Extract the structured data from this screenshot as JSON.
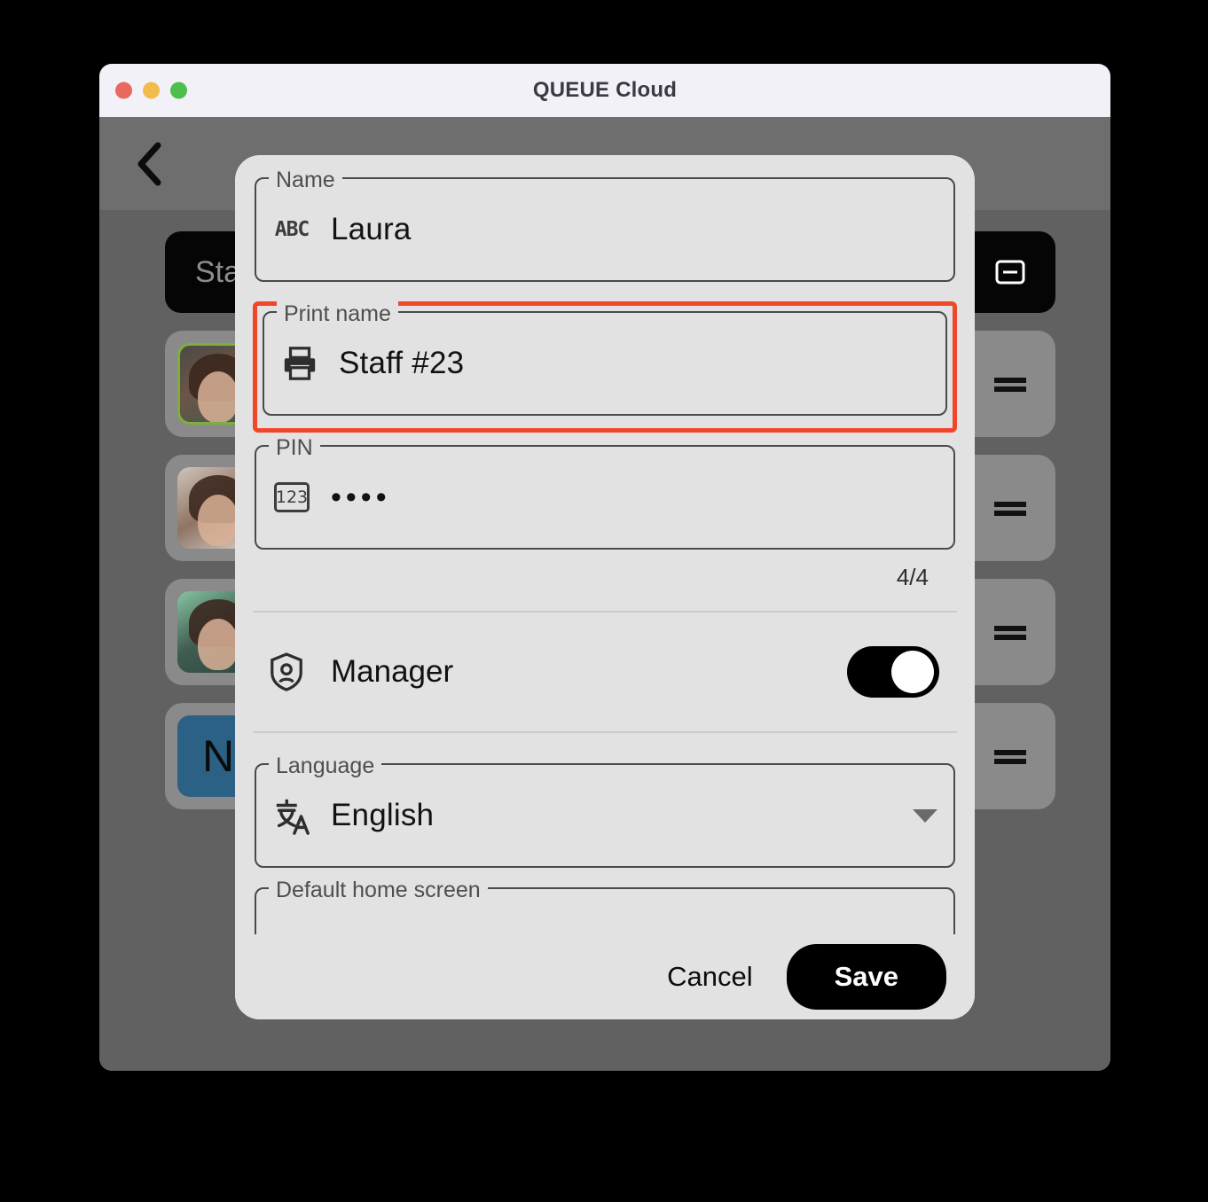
{
  "window": {
    "title": "QUEUE Cloud",
    "traffic_lights": [
      {
        "name": "close",
        "color": "#e8695e"
      },
      {
        "name": "minimize",
        "color": "#f0bc4d"
      },
      {
        "name": "zoom",
        "color": "#4cbf4f"
      }
    ]
  },
  "background": {
    "page_title": "Staff",
    "back_label": "",
    "black_button_label": "Sta",
    "rows": [
      {
        "name": "staff-row-1",
        "avatar": "photo-woman-long-hair",
        "selected": true
      },
      {
        "name": "staff-row-2",
        "avatar": "photo-woman-glasses",
        "selected": false
      },
      {
        "name": "staff-row-3",
        "avatar": "photo-man-beard",
        "selected": false
      },
      {
        "name": "staff-row-4",
        "avatar": "initial-tile",
        "initial": "N",
        "selected": false
      }
    ]
  },
  "dialog": {
    "fields": {
      "name": {
        "label": "Name",
        "value": "Laura",
        "icon": "abc-icon",
        "icon_text": "ABC"
      },
      "print_name": {
        "label": "Print name",
        "value": "Staff #23",
        "icon": "printer-icon",
        "highlighted": true,
        "highlight_color": "#f0462a"
      },
      "pin": {
        "label": "PIN",
        "value": "••••",
        "icon": "numeric-123-icon",
        "icon_text": "123",
        "counter": "4/4"
      },
      "manager": {
        "label": "Manager",
        "icon": "shield-person-icon",
        "enabled": true
      },
      "language": {
        "label": "Language",
        "value": "English",
        "icon": "translate-icon"
      },
      "default_home_screen": {
        "label": "Default home screen",
        "value": ""
      }
    },
    "footer": {
      "cancel_label": "Cancel",
      "save_label": "Save"
    }
  }
}
